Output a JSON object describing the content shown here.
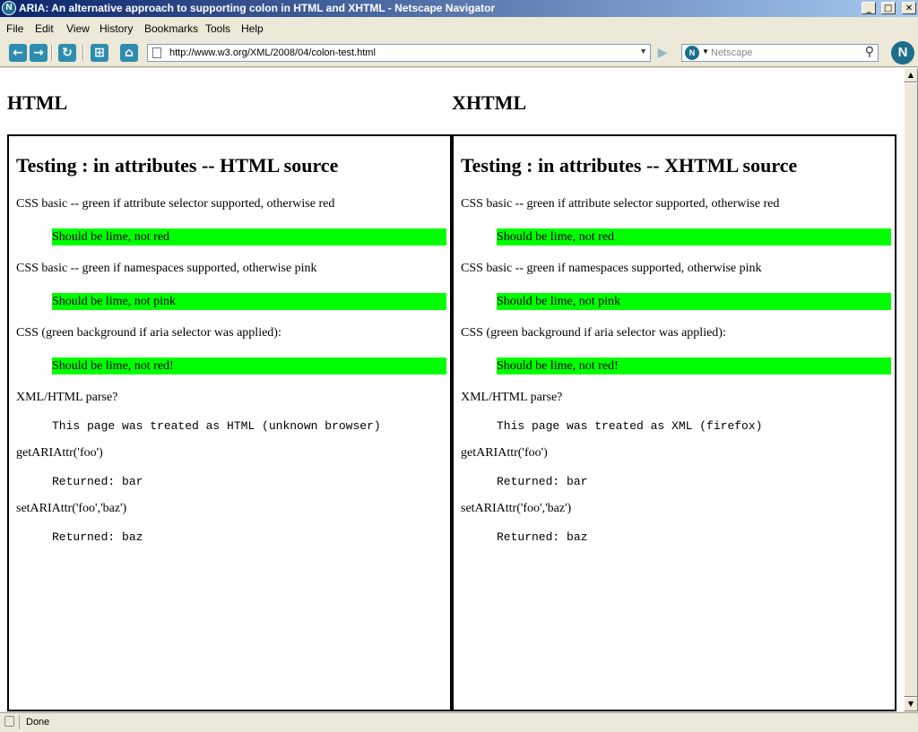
{
  "window": {
    "title": "ARIA: An alternative approach to supporting colon in HTML and XHTML - Netscape Navigator",
    "minimize": "_",
    "maximize": "□",
    "close": "✕"
  },
  "menu": {
    "file": "File",
    "edit": "Edit",
    "view": "View",
    "history": "History",
    "bookmarks": "Bookmarks",
    "tools": "Tools",
    "help": "Help"
  },
  "toolbar": {
    "url": "http://www.w3.org/XML/2008/04/colon-test.html",
    "search_placeholder": "Netscape",
    "icons": [
      "back-icon",
      "forward-icon",
      "reload-icon",
      "new-tab-icon",
      "home-icon",
      "go-icon",
      "search-icon",
      "netscape-logo-icon"
    ]
  },
  "page": {
    "left_heading": "HTML",
    "right_heading": "XHTML",
    "left": {
      "title": "Testing : in attributes -- HTML source",
      "css_attr_label": "CSS basic -- green if attribute selector supported, otherwise red",
      "css_attr_box": "Should be lime, not red",
      "css_ns_label": "CSS basic -- green if namespaces supported, otherwise pink",
      "css_ns_box": "Should be lime, not pink",
      "css_aria_label": "CSS (green background if aria selector was applied):",
      "css_aria_box": "Should be lime, not red!",
      "parse_label": "XML/HTML parse?",
      "parse_result": "This page was treated as HTML (unknown browser)",
      "get_label": "getARIAttr('foo')",
      "get_result": "Returned: bar",
      "set_label": "setARIAttr('foo','baz')",
      "set_result": "Returned: baz"
    },
    "right": {
      "title": "Testing : in attributes -- XHTML source",
      "css_attr_label": "CSS basic -- green if attribute selector supported, otherwise red",
      "css_attr_box": "Should be lime, not red",
      "css_ns_label": "CSS basic -- green if namespaces supported, otherwise pink",
      "css_ns_box": "Should be lime, not pink",
      "css_aria_label": "CSS (green background if aria selector was applied):",
      "css_aria_box": "Should be lime, not red!",
      "parse_label": "XML/HTML parse?",
      "parse_result": "This page was treated as XML (firefox)",
      "get_label": "getARIAttr('foo')",
      "get_result": "Returned: bar",
      "set_label": "setARIAttr('foo','baz')",
      "set_result": "Returned: baz"
    }
  },
  "status": {
    "text": "Done"
  },
  "colors": {
    "lime": "#00ff00",
    "titlebar_start": "#0a246a",
    "titlebar_end": "#a6caf0"
  }
}
